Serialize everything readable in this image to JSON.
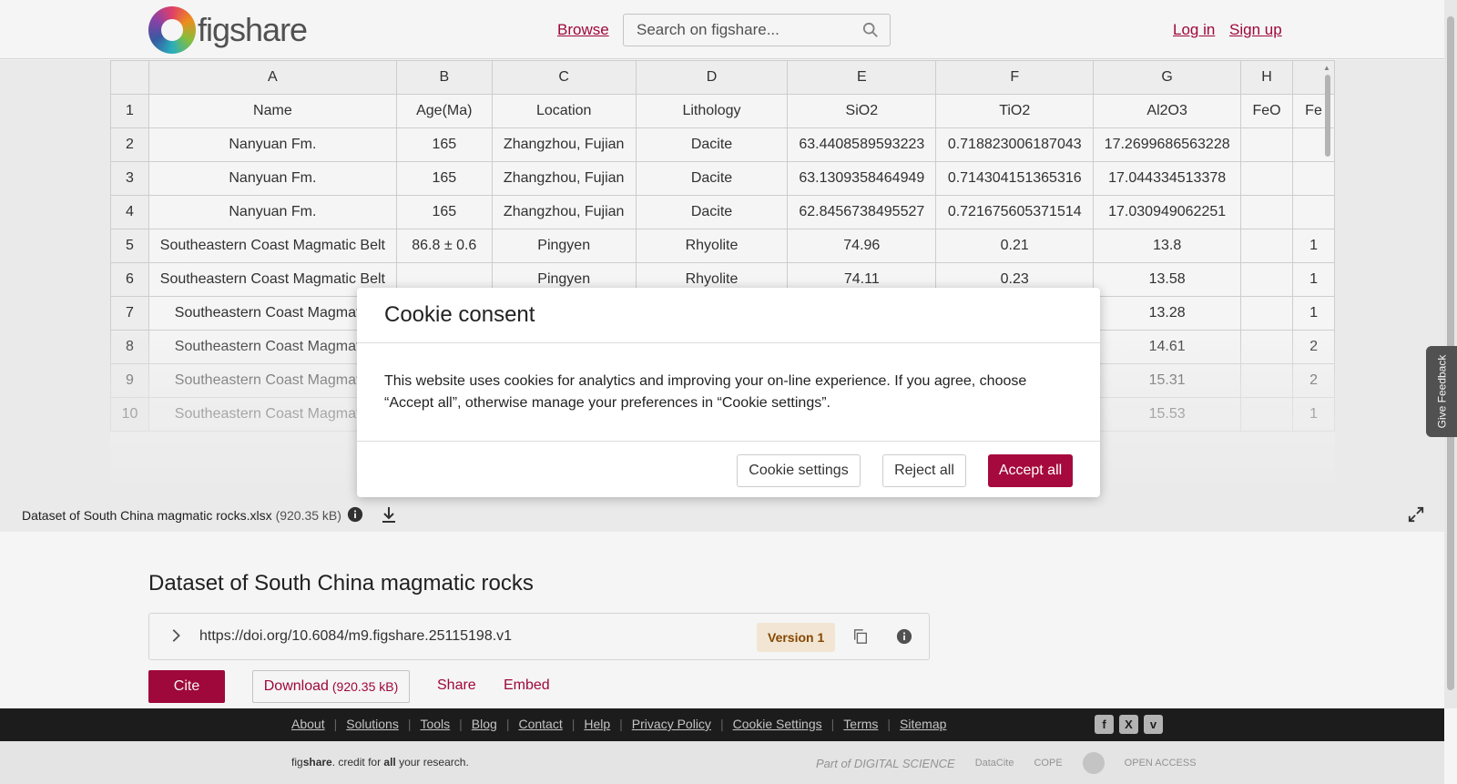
{
  "header": {
    "logo_text": "figshare",
    "browse": "Browse",
    "search_placeholder": "Search on figshare...",
    "login": "Log in",
    "signup": "Sign up"
  },
  "sheet": {
    "col_headers": [
      "",
      "A",
      "B",
      "C",
      "D",
      "E",
      "F",
      "G",
      "H",
      ""
    ],
    "rows": [
      [
        "1",
        "Name",
        "Age(Ma)",
        "Location",
        "Lithology",
        "SiO2",
        "TiO2",
        "Al2O3",
        "FeO",
        "Fe"
      ],
      [
        "2",
        "Nanyuan Fm.",
        "165",
        "Zhangzhou, Fujian",
        "Dacite",
        "63.4408589593223",
        "0.718823006187043",
        "17.2699686563228",
        "",
        ""
      ],
      [
        "3",
        "Nanyuan Fm.",
        "165",
        "Zhangzhou, Fujian",
        "Dacite",
        "63.1309358464949",
        "0.714304151365316",
        "17.044334513378",
        "",
        ""
      ],
      [
        "4",
        "Nanyuan Fm.",
        "165",
        "Zhangzhou, Fujian",
        "Dacite",
        "62.8456738495527",
        "0.721675605371514",
        "17.030949062251",
        "",
        ""
      ],
      [
        "5",
        "Southeastern Coast Magmatic Belt",
        "86.8 ± 0.6",
        "Pingyen",
        "Rhyolite",
        "74.96",
        "0.21",
        "13.8",
        "",
        "1"
      ],
      [
        "6",
        "Southeastern Coast Magmatic Belt",
        "",
        "Pingyen",
        "Rhyolite",
        "74.11",
        "0.23",
        "13.58",
        "",
        "1"
      ],
      [
        "7",
        "Southeastern Coast Magmatic",
        "",
        "",
        "",
        "",
        "",
        "13.28",
        "",
        "1"
      ],
      [
        "8",
        "Southeastern Coast Magmatic",
        "",
        "",
        "",
        "",
        "",
        "14.61",
        "",
        "2"
      ],
      [
        "9",
        "Southeastern Coast Magmatic",
        "",
        "",
        "",
        "",
        "",
        "15.31",
        "",
        "2"
      ],
      [
        "10",
        "Southeastern Coast Magmatic",
        "",
        "",
        "",
        "",
        "",
        "15.53",
        "",
        "1"
      ]
    ]
  },
  "filebar": {
    "filename": "Dataset of South China magmatic rocks.xlsx",
    "filesize": "(920.35 kB)"
  },
  "content": {
    "title": "Dataset of South China magmatic rocks",
    "doi": "https://doi.org/10.6084/m9.figshare.25115198.v1",
    "version": "Version 1",
    "cite": "Cite",
    "download": "Download",
    "download_size": "(920.35 kB)",
    "share": "Share",
    "embed": "Embed"
  },
  "footer": {
    "links": [
      "About",
      "Solutions",
      "Tools",
      "Blog",
      "Contact",
      "Help",
      "Privacy Policy",
      "Cookie Settings",
      "Terms",
      "Sitemap"
    ],
    "tagline_pre": "fig",
    "tagline_brand": "share",
    "tagline_mid": ". credit for ",
    "tagline_all": "all",
    "tagline_post": " your research.",
    "partner_ds": "Part of DIGITAL SCIENCE",
    "partner_datacite": "DataCite",
    "partner_cope": "COPE",
    "partner_oa": "OPEN ACCESS",
    "social": [
      "f",
      "X",
      "v"
    ]
  },
  "feedback": "Give Feedback",
  "cookie": {
    "title": "Cookie consent",
    "body": "This website uses cookies for analytics and improving your on-line experience. If you agree, choose “Accept all”, otherwise manage your preferences in “Cookie settings”.",
    "settings": "Cookie settings",
    "reject": "Reject all",
    "accept": "Accept all"
  },
  "colors": {
    "brand": "#a6093d"
  }
}
